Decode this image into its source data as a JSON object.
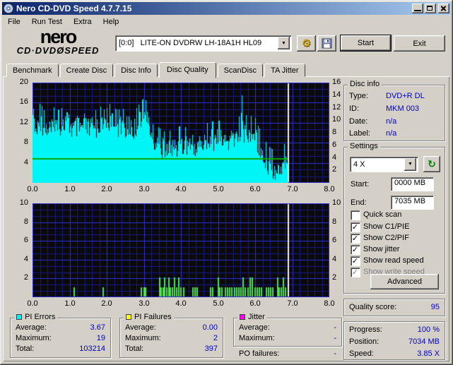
{
  "window": {
    "title": "Nero CD-DVD Speed 4.7.7.15"
  },
  "menu": {
    "items": [
      "File",
      "Run Test",
      "Extra",
      "Help"
    ]
  },
  "toolbar": {
    "logo_top": "nero",
    "logo_bottom_left": "CD·DVD",
    "logo_disc": "Ø",
    "logo_bottom_right": "SPEED",
    "drive": "[0:0]   LITE-ON DVDRW LH-18A1H HL09",
    "gears_icon": "⚙",
    "dropdown_arrow": "▼",
    "start": "Start",
    "exit": "Exit"
  },
  "tabs": [
    "Benchmark",
    "Create Disc",
    "Disc Info",
    "Disc Quality",
    "ScanDisc",
    "TA Jitter"
  ],
  "active_tab": "Disc Quality",
  "disc_info": {
    "title": "Disc info",
    "type_label": "Type:",
    "type": "DVD+R DL",
    "id_label": "ID:",
    "id": "MKM 003",
    "date_label": "Date:",
    "date": "n/a",
    "label_label": "Label:",
    "label": "n/a"
  },
  "settings": {
    "title": "Settings",
    "speed": "4 X",
    "refresh_icon": "↻",
    "dropdown_arrow": "▼",
    "start_label": "Start:",
    "start": "0000 MB",
    "end_label": "End:",
    "end": "7035 MB",
    "checkboxes": [
      {
        "label": "Quick scan",
        "mark": "",
        "disabled": false
      },
      {
        "label": "Show C1/PIE",
        "mark": "✓",
        "disabled": false
      },
      {
        "label": "Show C2/PIF",
        "mark": "✓",
        "disabled": false
      },
      {
        "label": "Show jitter",
        "mark": "✓",
        "disabled": false
      },
      {
        "label": "Show read speed",
        "mark": "✓",
        "disabled": false
      },
      {
        "label": "Show write speed",
        "mark": "✓",
        "disabled": true
      }
    ],
    "advanced": "Advanced"
  },
  "quality": {
    "label": "Quality score:",
    "value": "95"
  },
  "status": {
    "progress_label": "Progress:",
    "progress": "100 %",
    "position_label": "Position:",
    "position": "7034 MB",
    "speed_label": "Speed:",
    "speed": "3.85 X"
  },
  "stats": {
    "pi_errors": {
      "title": "PI Errors",
      "swatch": "#00F6F6",
      "avg_label": "Average:",
      "avg": "3.67",
      "max_label": "Maximum:",
      "max": "19",
      "total_label": "Total:",
      "total": "103214"
    },
    "pi_failures": {
      "title": "PI Failures",
      "swatch": "#FFFF00",
      "avg_label": "Average:",
      "avg": "0.00",
      "max_label": "Maximum:",
      "max": "2",
      "total_label": "Total:",
      "total": "397"
    },
    "jitter": {
      "title": "Jitter",
      "swatch": "#FF00FF",
      "avg_label": "Average:",
      "avg": "-",
      "max_label": "Maximum:",
      "max": "-"
    },
    "po_label": "PO failures:",
    "po": "-"
  },
  "chart_data": [
    {
      "type": "area",
      "name": "PI Errors scan",
      "x_axis": {
        "min": 0,
        "max": 8,
        "ticks": [
          "0.0",
          "1.0",
          "2.0",
          "3.0",
          "4.0",
          "5.0",
          "6.0",
          "7.0",
          "8.0"
        ],
        "unit": "GB"
      },
      "y_left": {
        "min": 0,
        "max": 20,
        "ticks": [
          20,
          16,
          12,
          8,
          4
        ]
      },
      "y_right": {
        "min": 0,
        "max": 16,
        "ticks": [
          16,
          14,
          12,
          10,
          8,
          6,
          4,
          2
        ]
      },
      "data_end_gb": 6.87,
      "position_marker_gb": 6.87,
      "series": [
        {
          "name": "PI Errors",
          "color": "#00F6F6",
          "axis": "left",
          "style": "spiky-area",
          "envelope": [
            [
              0,
              15
            ],
            [
              0.1,
              14
            ],
            [
              0.2,
              16
            ],
            [
              0.3,
              14.5
            ],
            [
              0.4,
              15
            ],
            [
              0.5,
              14
            ],
            [
              0.6,
              15.5
            ],
            [
              0.7,
              14.5
            ],
            [
              0.8,
              15
            ],
            [
              0.9,
              16.5
            ],
            [
              1.0,
              15.5
            ],
            [
              1.1,
              14.5
            ],
            [
              1.2,
              15
            ],
            [
              1.3,
              14.5
            ],
            [
              1.4,
              15.5
            ],
            [
              1.5,
              14.5
            ],
            [
              1.6,
              15
            ],
            [
              1.7,
              14.5
            ],
            [
              1.8,
              15.5
            ],
            [
              1.9,
              14.5
            ],
            [
              2.0,
              15
            ],
            [
              2.1,
              16
            ],
            [
              2.2,
              15
            ],
            [
              2.3,
              14.5
            ],
            [
              2.4,
              15
            ],
            [
              2.5,
              14.5
            ],
            [
              2.6,
              15.5
            ],
            [
              2.7,
              14.5
            ],
            [
              2.8,
              15
            ],
            [
              2.9,
              16
            ],
            [
              3.0,
              17
            ],
            [
              3.1,
              16
            ],
            [
              3.2,
              14
            ],
            [
              3.3,
              12
            ],
            [
              3.4,
              11
            ],
            [
              3.5,
              10.5
            ],
            [
              3.6,
              10
            ],
            [
              3.7,
              10.5
            ],
            [
              3.8,
              11
            ],
            [
              3.9,
              11
            ],
            [
              4.0,
              11.5
            ],
            [
              4.1,
              11
            ],
            [
              4.2,
              12
            ],
            [
              4.3,
              11.5
            ],
            [
              4.4,
              11
            ],
            [
              4.5,
              12
            ],
            [
              4.6,
              11.5
            ],
            [
              4.7,
              12
            ],
            [
              4.8,
              12.5
            ],
            [
              4.9,
              12
            ],
            [
              5.0,
              12.5
            ],
            [
              5.1,
              12
            ],
            [
              5.2,
              12.5
            ],
            [
              5.3,
              12
            ],
            [
              5.4,
              13
            ],
            [
              5.5,
              13
            ],
            [
              5.6,
              13.5
            ],
            [
              5.63,
              19
            ],
            [
              5.66,
              13.5
            ],
            [
              5.7,
              14
            ],
            [
              5.8,
              13
            ],
            [
              5.9,
              13.5
            ],
            [
              6.0,
              13
            ],
            [
              6.05,
              12
            ],
            [
              6.1,
              11
            ],
            [
              6.2,
              9.5
            ],
            [
              6.3,
              8
            ],
            [
              6.4,
              7
            ],
            [
              6.5,
              6.5
            ],
            [
              6.6,
              6
            ],
            [
              6.7,
              7
            ],
            [
              6.8,
              8
            ],
            [
              6.87,
              7
            ]
          ]
        },
        {
          "name": "Read speed",
          "color": "#00A800",
          "axis": "right",
          "style": "line",
          "points": [
            [
              0,
              4
            ],
            [
              6.87,
              4
            ]
          ]
        }
      ]
    },
    {
      "type": "bar",
      "name": "PI Failures scan",
      "x_axis": {
        "min": 0,
        "max": 8,
        "ticks": [
          "0.0",
          "1.0",
          "2.0",
          "3.0",
          "4.0",
          "5.0",
          "6.0",
          "7.0",
          "8.0"
        ],
        "unit": "GB"
      },
      "y_left": {
        "min": 0,
        "max": 10,
        "ticks": [
          10,
          8,
          6,
          4,
          2
        ]
      },
      "y_right": {
        "min": 0,
        "max": 10,
        "ticks": [
          10,
          8,
          6,
          4,
          2
        ]
      },
      "position_marker_gb": 6.87,
      "bars": {
        "color": "#50E050",
        "values": [
          [
            1.13,
            1
          ],
          [
            1.9,
            1
          ],
          [
            2.93,
            1
          ],
          [
            3.0,
            1
          ],
          [
            3.05,
            1
          ],
          [
            3.42,
            2
          ],
          [
            3.47,
            1
          ],
          [
            3.52,
            1
          ],
          [
            3.57,
            2
          ],
          [
            3.62,
            1
          ],
          [
            3.67,
            2
          ],
          [
            3.72,
            1
          ],
          [
            3.78,
            1
          ],
          [
            3.83,
            2
          ],
          [
            3.88,
            1
          ],
          [
            3.95,
            2
          ],
          [
            4.0,
            1
          ],
          [
            4.07,
            1
          ],
          [
            4.33,
            1
          ],
          [
            4.38,
            1
          ],
          [
            4.44,
            1
          ],
          [
            4.8,
            1
          ],
          [
            4.85,
            1
          ],
          [
            5.0,
            2
          ],
          [
            5.04,
            1
          ],
          [
            5.1,
            1
          ],
          [
            5.2,
            1
          ],
          [
            5.26,
            1
          ],
          [
            5.32,
            1
          ],
          [
            5.38,
            1
          ],
          [
            5.44,
            1
          ],
          [
            5.5,
            1
          ],
          [
            5.56,
            1
          ],
          [
            5.62,
            1
          ],
          [
            5.68,
            2
          ],
          [
            5.74,
            1
          ],
          [
            5.8,
            1
          ],
          [
            5.86,
            2
          ],
          [
            5.92,
            2
          ],
          [
            6.0,
            1
          ],
          [
            6.05,
            1
          ],
          [
            6.12,
            1
          ],
          [
            6.18,
            1
          ],
          [
            6.3,
            1
          ],
          [
            6.36,
            1
          ],
          [
            6.42,
            1
          ],
          [
            6.48,
            1
          ],
          [
            6.6,
            2
          ],
          [
            6.65,
            1
          ],
          [
            6.7,
            1
          ],
          [
            6.76,
            2
          ],
          [
            6.82,
            1
          ]
        ]
      }
    }
  ],
  "colors": {
    "value_text": "#0000C8",
    "chart_bg": "#0A0A0A",
    "grid_minor": "#18188C",
    "grid_major": "#3030D8",
    "pie_area": "#00F6F6",
    "pif_bars": "#50E050",
    "speed_line": "#00A800",
    "marker": "#F2F2F2",
    "titlebar_left": "#0A246A",
    "titlebar_right": "#A6CAF0"
  }
}
